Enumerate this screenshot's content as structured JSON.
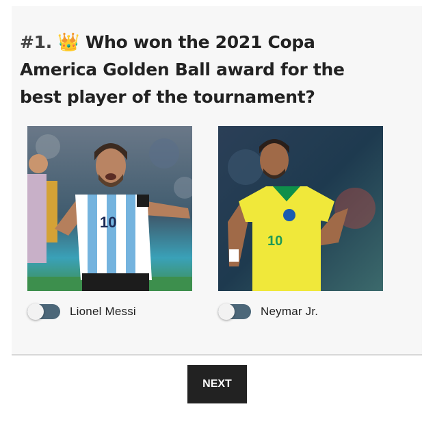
{
  "quiz": {
    "number": "#1.",
    "emoji": "👑",
    "question": "Who won the 2021 Copa America Golden Ball award for the best player of the tournament?",
    "options": [
      {
        "label": "Lionel Messi",
        "selected": false
      },
      {
        "label": "Neymar Jr.",
        "selected": false
      }
    ],
    "next_label": "NEXT"
  },
  "colors": {
    "card_bg": "#f7f7f7",
    "toggle": "#4c6779",
    "button": "#222222"
  }
}
